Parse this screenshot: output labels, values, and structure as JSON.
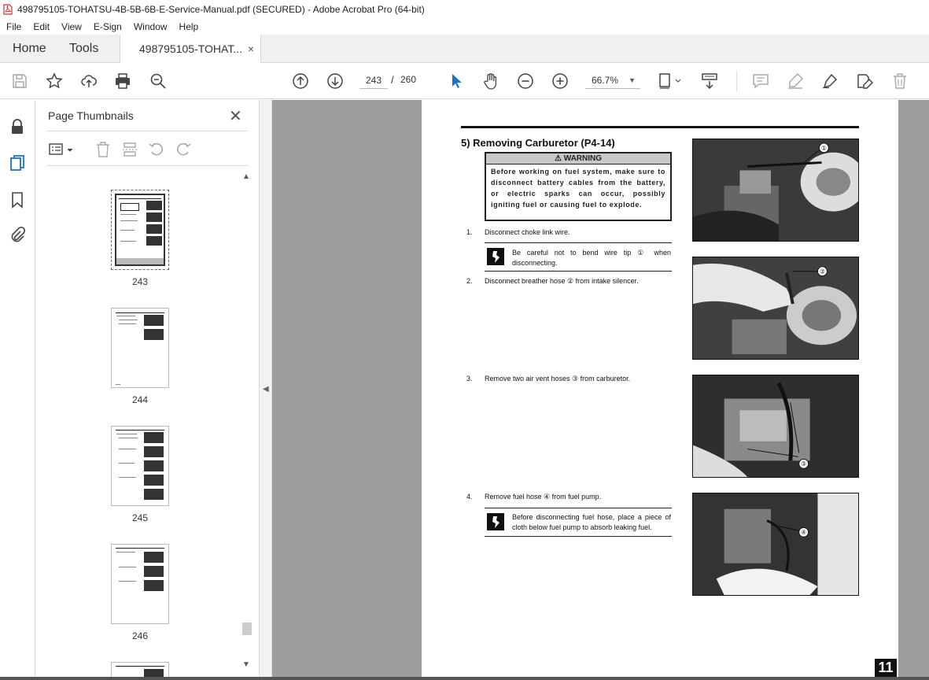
{
  "window": {
    "title": "498795105-TOHATSU-4B-5B-6B-E-Service-Manual.pdf (SECURED) - Adobe Acrobat Pro (64-bit)"
  },
  "menu": [
    "File",
    "Edit",
    "View",
    "E-Sign",
    "Window",
    "Help"
  ],
  "tabs": {
    "home": "Home",
    "tools": "Tools",
    "document": "498795105-TOHAT...",
    "close_glyph": "×"
  },
  "toolbar": {
    "current_page": "243",
    "separator": "/",
    "total_pages": "260",
    "zoom": "66.7%"
  },
  "thumbnails_panel": {
    "title": "Page Thumbnails",
    "pages": [
      "243",
      "244",
      "245",
      "246"
    ]
  },
  "document_page": {
    "section_title": "5) Removing Carburetor (P4-14)",
    "warning": {
      "header": "WARNING",
      "text": "Before working on fuel system, make sure to disconnect battery cables from the battery, or electric sparks can occur, possibly igniting fuel or causing fuel to explode."
    },
    "steps": [
      {
        "num": "1.",
        "text": "Disconnect choke link wire."
      },
      {
        "num": "2.",
        "text": "Disconnect breather hose ② from intake silencer."
      },
      {
        "num": "3.",
        "text": "Remove two air vent hoses ③ from carburetor."
      },
      {
        "num": "4.",
        "text": "Remove fuel hose ④ from fuel pump."
      }
    ],
    "notes": [
      "Be careful not to bend wire tip ① when disconnecting.",
      "Before disconnecting fuel hose, place a piece of cloth below fuel pump to absorb leaking fuel."
    ],
    "photo_callouts": [
      "①",
      "②",
      "③",
      "④"
    ],
    "page_number": "11"
  },
  "colors": {
    "viewer_bg": "#9e9e9e",
    "accent_blue": "#1a73c8",
    "pdf_red": "#d93025"
  }
}
